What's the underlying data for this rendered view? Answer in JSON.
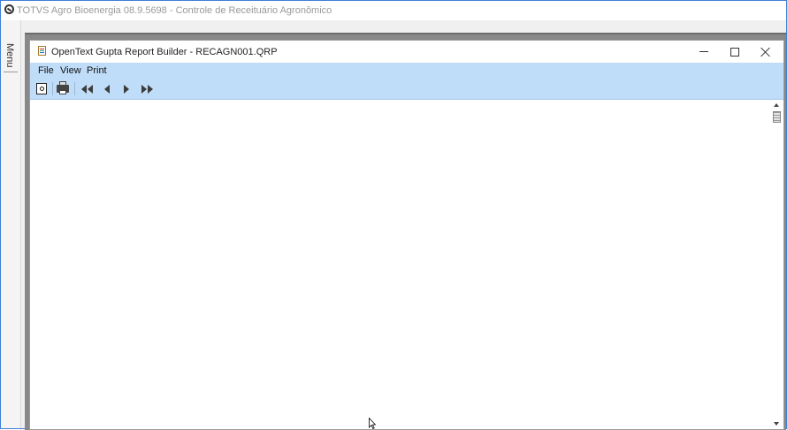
{
  "app": {
    "title": "TOTVS Agro Bioenergia 08.9.5698 - Controle de Receituário Agronômico",
    "side_menu_label": "Menu"
  },
  "report_window": {
    "title": "OpenText Gupta Report Builder - RECAGN001.QRP",
    "menu": [
      "File",
      "View",
      "Print"
    ],
    "toolbar": {
      "preview": "print-preview-icon",
      "print": "printer-icon",
      "first": "first-page-icon",
      "prev": "previous-page-icon",
      "next": "next-page-icon",
      "last": "last-page-icon"
    }
  },
  "colors": {
    "toolbar_bg": "#bfdcf8",
    "frame_border": "#3d7fd6",
    "title_text": "#9a9a9a"
  }
}
